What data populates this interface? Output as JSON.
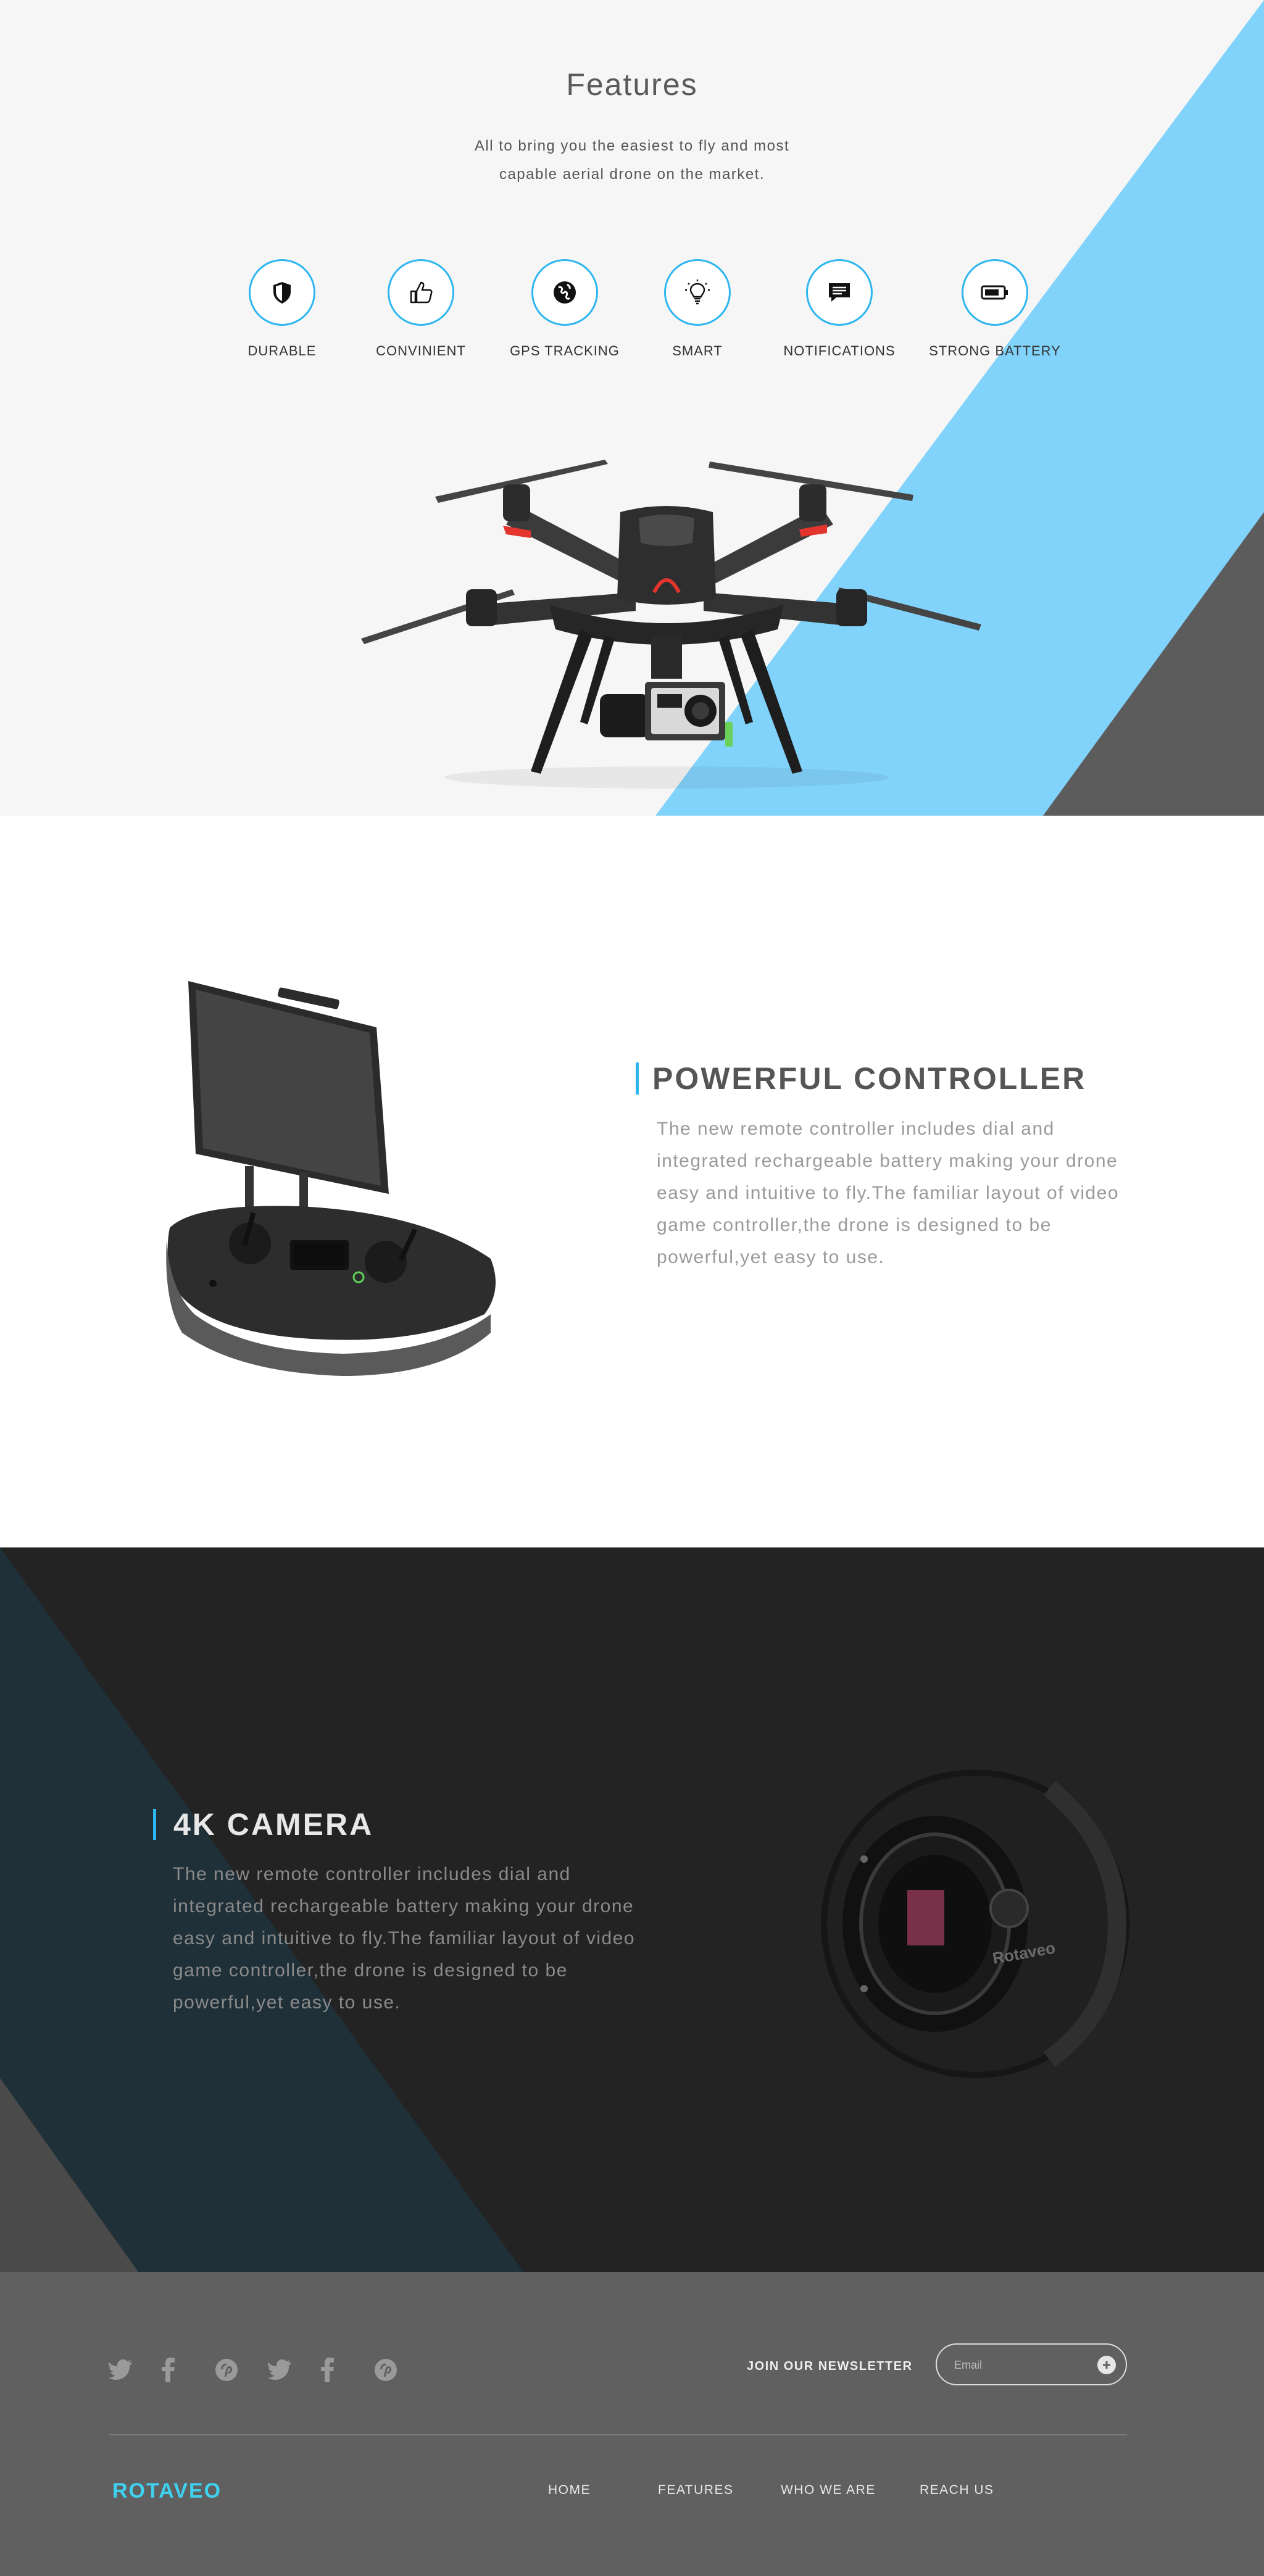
{
  "features": {
    "title": "Features",
    "subtitle": "All to bring you the easiest to fly and most capable aerial drone on the market.",
    "items": [
      {
        "label": "DURABLE",
        "icon": "shield-icon"
      },
      {
        "label": "CONVINIENT",
        "icon": "thumbs-up-icon"
      },
      {
        "label": "GPS TRACKING",
        "icon": "globe-icon"
      },
      {
        "label": "SMART",
        "icon": "lightbulb-icon"
      },
      {
        "label": "NOTIFICATIONS",
        "icon": "chat-icon"
      },
      {
        "label": "STRONG BATTERY",
        "icon": "battery-icon"
      }
    ],
    "colors": {
      "accent": "#2eb6f0",
      "triangle_blue": "#82d3fb",
      "triangle_gray": "#5c5c5c"
    }
  },
  "controller": {
    "title": "POWERFUL CONTROLLER",
    "text": "The new remote controller includes dial and integrated rechargeable battery making your drone easy and intuitive to fly.The familiar layout of video game controller,the drone is designed to be powerful,yet easy to use."
  },
  "camera": {
    "title": "4K CAMERA",
    "text": "The new remote controller includes dial and integrated rechargeable battery making your drone easy and intuitive to fly.The familiar layout of video game controller,the drone is designed to be powerful,yet easy to use.",
    "brand_mark": "Rotaveo",
    "colors": {
      "background": "#232323",
      "triangle": "#203038"
    }
  },
  "footer": {
    "social": [
      "twitter-icon",
      "facebook-icon",
      "pinterest-icon",
      "twitter-icon",
      "facebook-icon",
      "pinterest-icon"
    ],
    "newsletter_label": "JOIN OUR NEWSLETTER",
    "email_placeholder": "Email",
    "brand": "ROTAVEO",
    "nav": [
      "HOME",
      "FEATURES",
      "WHO WE ARE",
      "REACH US"
    ],
    "colors": {
      "background": "#606060",
      "brand": "#3fd2f0"
    }
  }
}
